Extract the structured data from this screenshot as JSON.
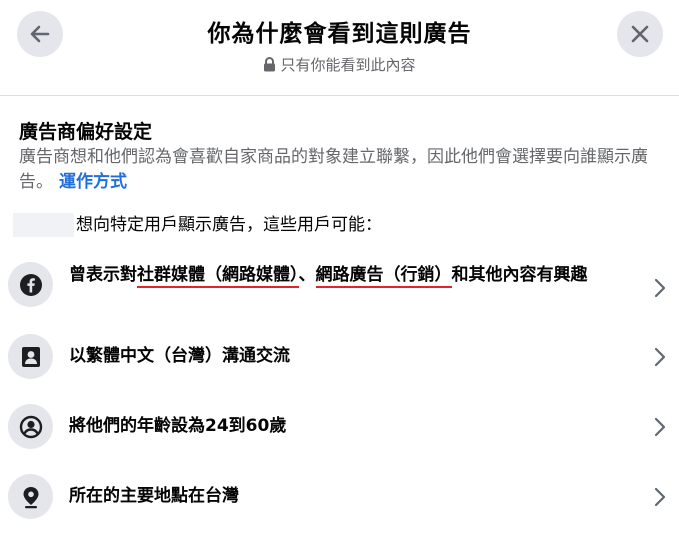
{
  "header": {
    "title": "你為什麼會看到這則廣告",
    "subtitle": "只有你能看到此內容",
    "back_icon": "arrow-left-icon",
    "close_icon": "close-icon",
    "lock_icon": "lock-icon"
  },
  "preferences": {
    "title": "廣告商偏好設定",
    "description": "廣告商想和他們認為會喜歡自家商品的對象建立聯繫，因此他們會選擇要向誰顯示廣告。",
    "link": "運作方式"
  },
  "targeting_intro": "想向特定用戶顯示廣告，這些用戶可能：",
  "rows": [
    {
      "icon": "facebook-icon",
      "parts": [
        "曾表示對",
        "社群媒體（網路媒體）",
        "、",
        "網路廣告（行銷）",
        "和其他內容有興趣"
      ]
    },
    {
      "icon": "contact-card-icon",
      "text": "以繁體中文（台灣）溝通交流"
    },
    {
      "icon": "person-circle-icon",
      "text": "將他們的年齡設為24到60歲"
    },
    {
      "icon": "location-pin-icon",
      "text": "所在的主要地點在台灣"
    }
  ],
  "colors": {
    "link": "#216fdb",
    "underline_highlight": "#e0242b",
    "icon_background": "#e4e6eb",
    "secondary_text": "#65676b"
  }
}
